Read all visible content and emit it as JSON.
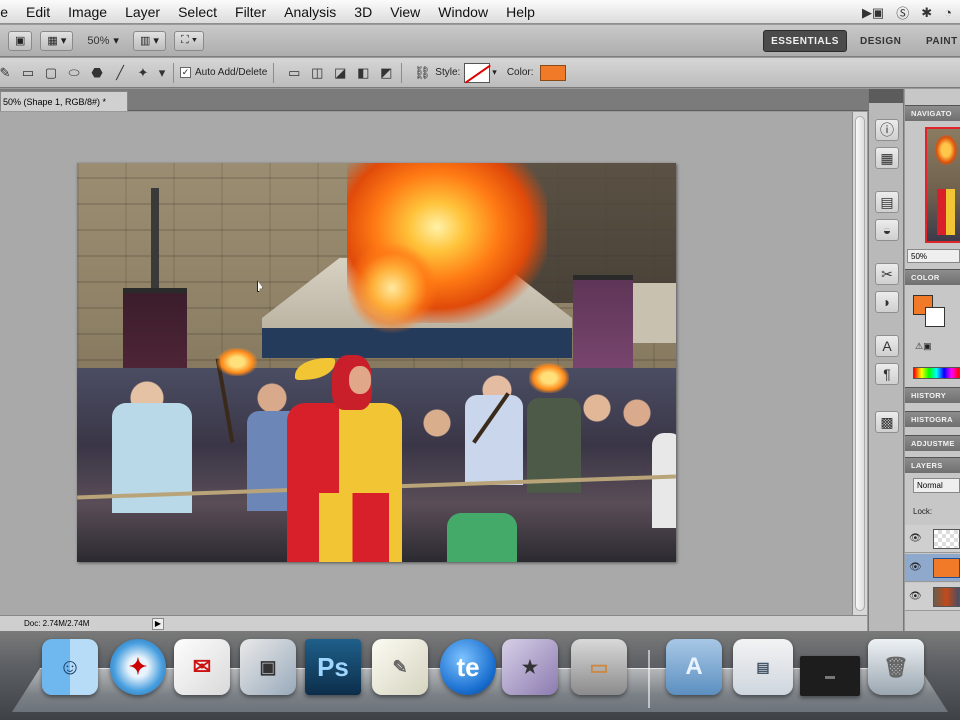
{
  "menubar": {
    "items": [
      "ile",
      "Edit",
      "Image",
      "Layer",
      "Select",
      "Filter",
      "Analysis",
      "3D",
      "View",
      "Window",
      "Help"
    ]
  },
  "appbar": {
    "zoom": "50%",
    "workspaces": [
      "ESSENTIALS",
      "DESIGN",
      "PAINT"
    ]
  },
  "options": {
    "auto_add_delete": "Auto Add/Delete",
    "style_label": "Style:",
    "color_label": "Color:",
    "accent": "#f07a28"
  },
  "document": {
    "tab_title": "50% (Shape 1, RGB/8#) *",
    "status": "Doc: 2.74M/2.74M"
  },
  "panels": {
    "navigator": "NAVIGATO",
    "navigator_zoom": "50%",
    "color": "COLOR",
    "history": "HISTORY",
    "histogram": "HISTOGRA",
    "adjustments": "ADJUSTME",
    "layers": "LAYERS",
    "blend_mode": "Normal",
    "lock_label": "Lock:"
  },
  "dock": {
    "items": [
      "Finder",
      "Safari",
      "Mail",
      "iPhoto",
      "Ps",
      "TextEdit",
      "te",
      "iMovie",
      "Keynote",
      "Applications",
      "Window",
      "Display",
      "Trash"
    ]
  }
}
